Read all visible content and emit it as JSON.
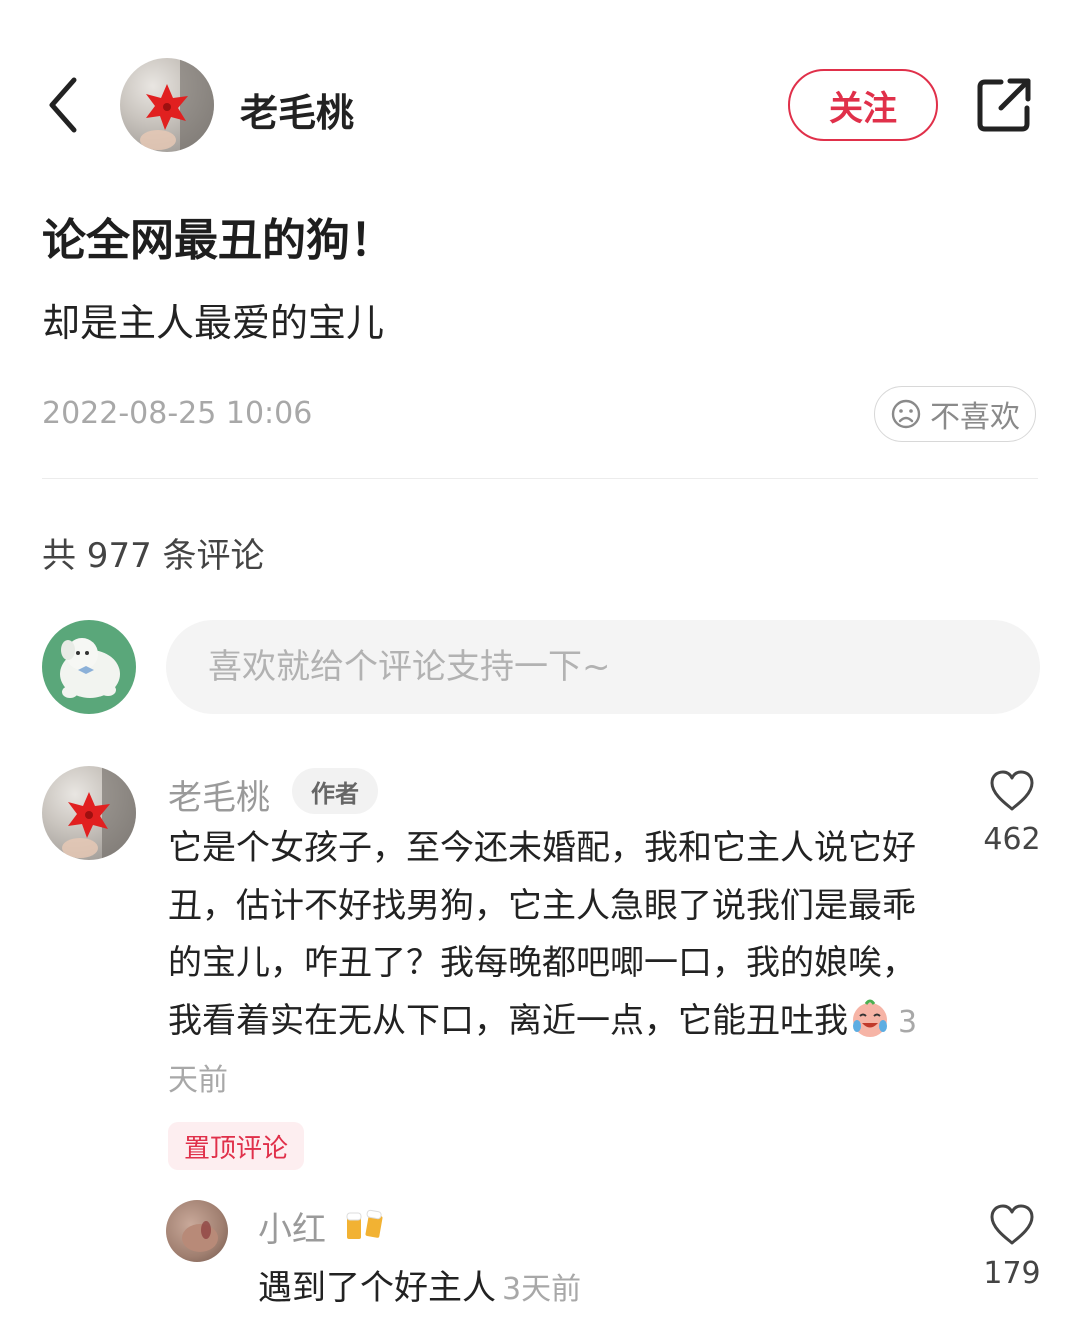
{
  "header": {
    "author_name": "老毛桃",
    "follow_label": "关注"
  },
  "post": {
    "title": "论全网最丑的狗！",
    "body": "却是主人最爱的宝儿",
    "time": "2022-08-25 10:06",
    "dislike_label": "不喜欢"
  },
  "comments_section": {
    "count_label": "共 977 条评论",
    "input_placeholder": "喜欢就给个评论支持一下~"
  },
  "top_comment": {
    "name": "老毛桃",
    "badge": "作者",
    "text": "它是个女孩子，至今还未婚配，我和它主人说它好丑，估计不好找男狗，它主人急眼了说我们是最乖的宝儿，咋丑了？我每晚都吧唧一口，我的娘唉，我看着实在无从下口，离近一点，它能丑吐我",
    "time": "3天前",
    "pin_label": "置顶评论",
    "likes": "462"
  },
  "reply": {
    "name": "小红",
    "text": "遇到了个好主人",
    "time": "3天前",
    "likes": "179"
  }
}
